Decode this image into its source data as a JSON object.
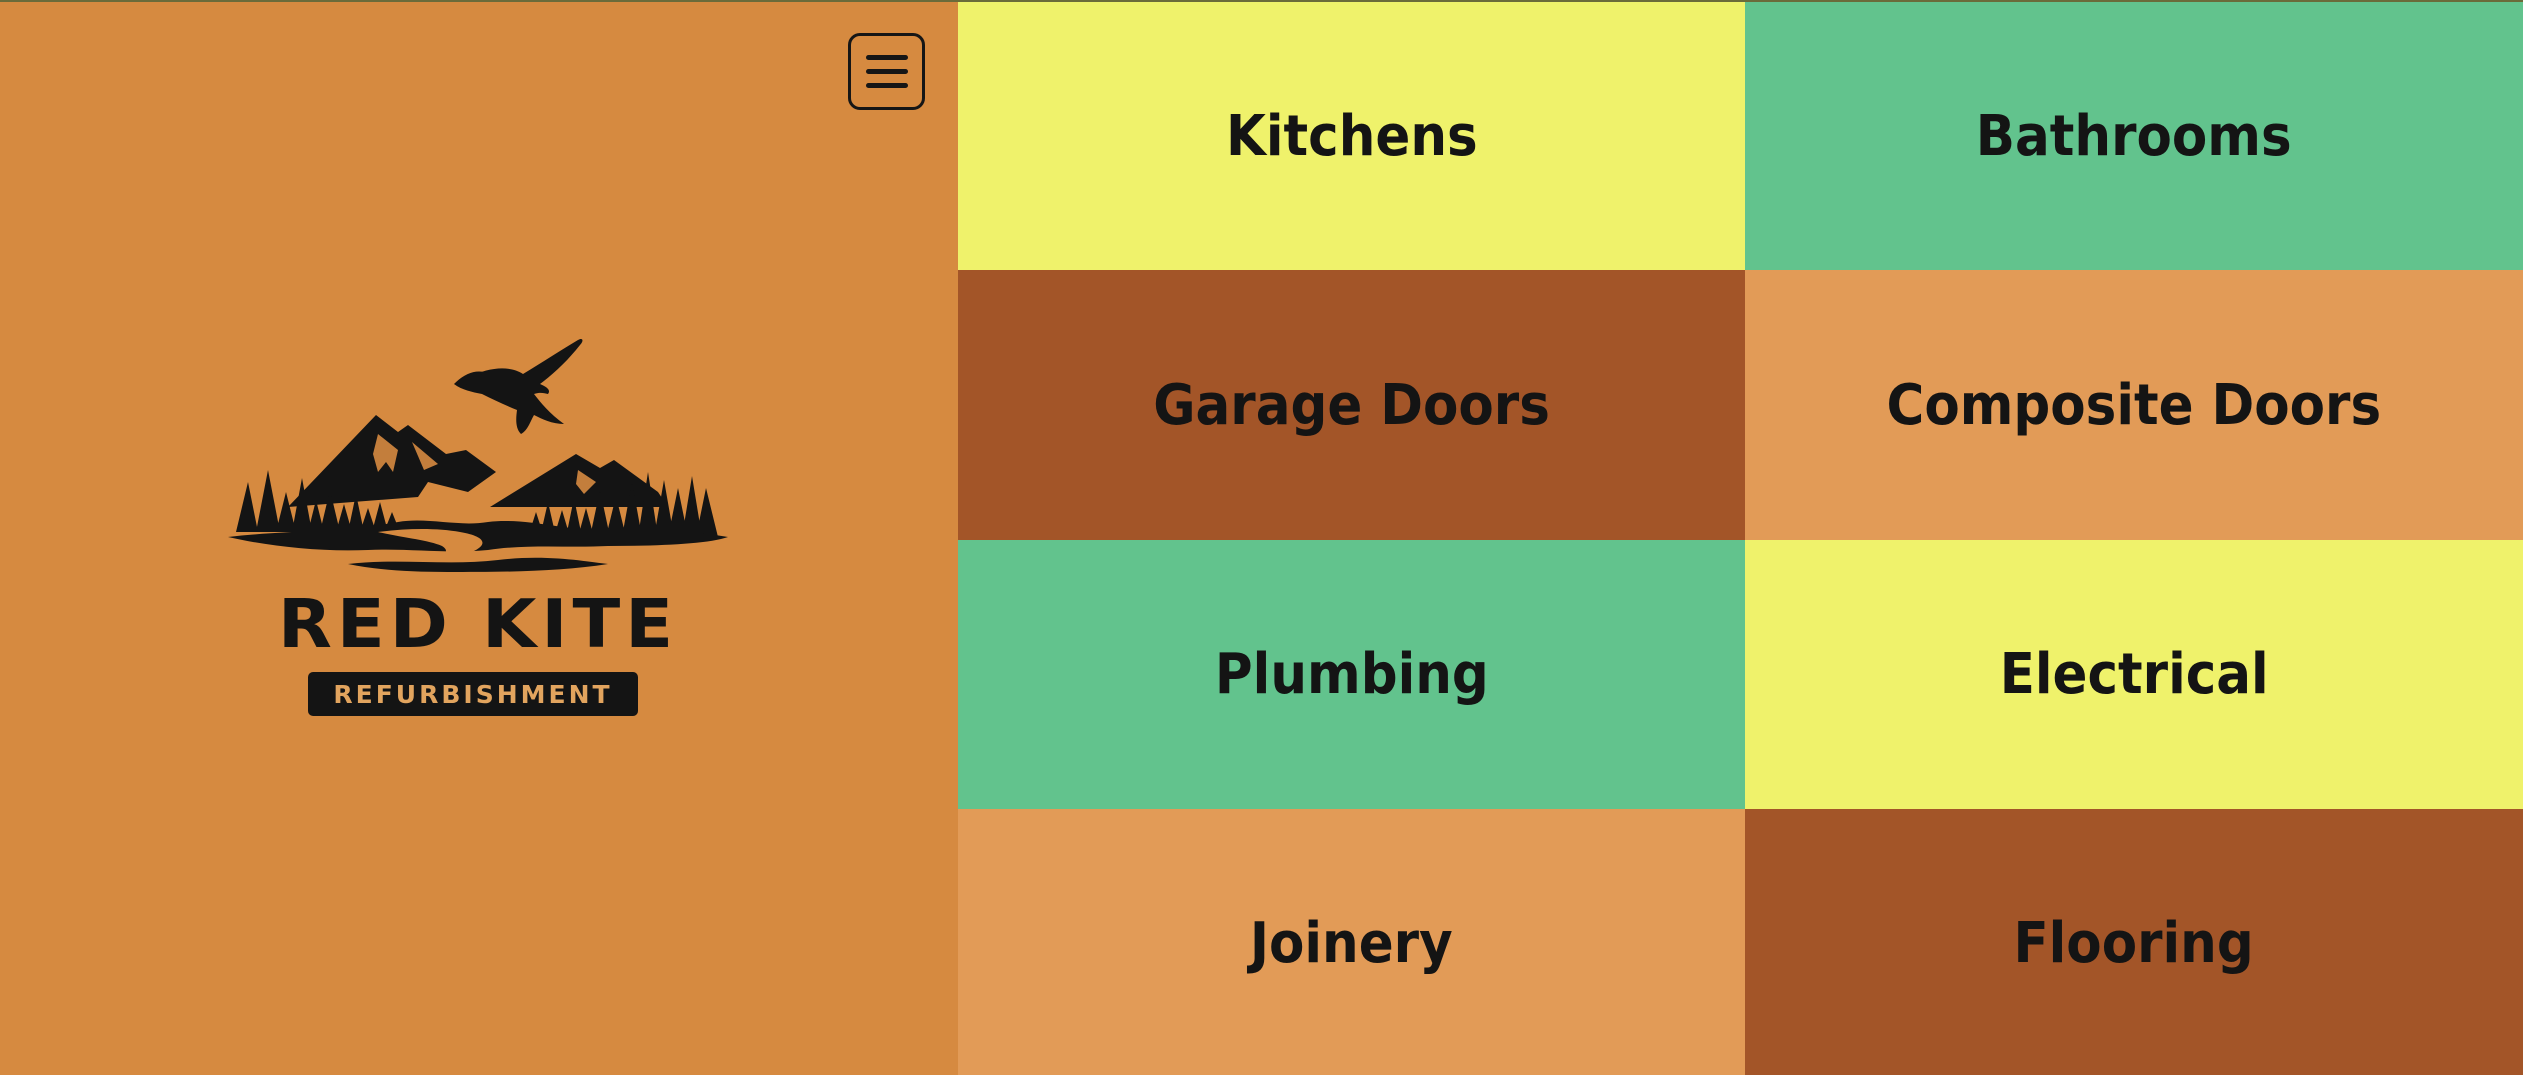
{
  "header": {
    "menu_icon": "hamburger-menu-icon"
  },
  "brand": {
    "name": "RED KITE",
    "tagline": "REFURBISHMENT",
    "logo_icon": "kite-over-mountains-icon"
  },
  "colors": {
    "page_background": "#d68a40",
    "yellow": "#eff26b",
    "green": "#62c38d",
    "brown": "#a35528",
    "light_orange": "#e29b57",
    "text": "#141414"
  },
  "services": [
    {
      "label": "Kitchens",
      "color": "#eff26b"
    },
    {
      "label": "Bathrooms",
      "color": "#62c38d"
    },
    {
      "label": "Garage Doors",
      "color": "#a35528"
    },
    {
      "label": "Composite Doors",
      "color": "#e29b57"
    },
    {
      "label": "Plumbing",
      "color": "#62c38d"
    },
    {
      "label": "Electrical",
      "color": "#eff26b"
    },
    {
      "label": "Joinery",
      "color": "#e29b57"
    },
    {
      "label": "Flooring",
      "color": "#a35528"
    }
  ]
}
